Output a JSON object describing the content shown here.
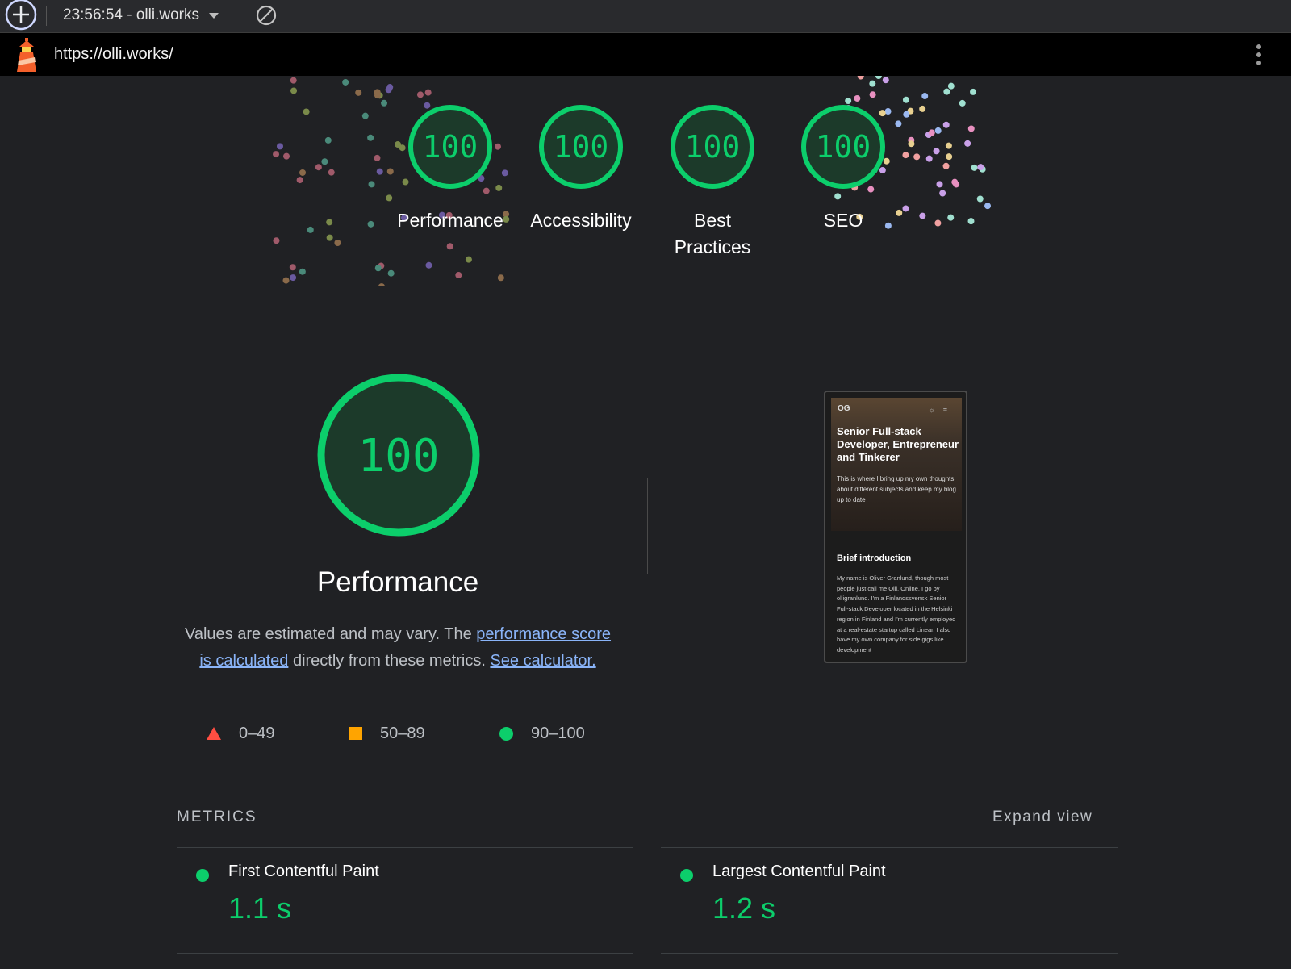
{
  "toolbar": {
    "report_label": "23:56:54 - olli.works"
  },
  "urlbar": {
    "url": "https://olli.works/"
  },
  "scores": [
    {
      "score": "100",
      "label": "Performance"
    },
    {
      "score": "100",
      "label": "Accessibility"
    },
    {
      "score": "100",
      "label": "Best Practices"
    },
    {
      "score": "100",
      "label": "SEO"
    }
  ],
  "performance": {
    "score": "100",
    "title": "Performance",
    "desc_1": "Values are estimated and may vary. The ",
    "desc_link_1": "performance score is calculated",
    "desc_2": " directly from these metrics. ",
    "desc_link_2": "See calculator.",
    "legend": [
      {
        "range": "0–49",
        "color": "#ff4e42"
      },
      {
        "range": "50–89",
        "color": "#ffa400"
      },
      {
        "range": "90–100",
        "color": "#0cce6b"
      }
    ]
  },
  "thumbnail": {
    "logo": "OG",
    "headline": "Senior Full-stack Developer, Entrepreneur and Tinkerer",
    "intro": "This is where I bring up my own thoughts about different subjects and keep my blog up to date",
    "section_title": "Brief introduction",
    "section_body": "My name is Oliver Granlund, though most people just call me Olli. Online, I go by olligranlund. I'm a Finlandssvensk Senior Full-stack Developer located in the Helsinki region in Finland and I'm currently employed at a real-estate startup called Linear. I also have my own company for side gigs like development"
  },
  "metrics": {
    "title": "METRICS",
    "expand_label": "Expand view",
    "items": [
      {
        "name": "First Contentful Paint",
        "value": "1.1 s"
      },
      {
        "name": "Largest Contentful Paint",
        "value": "1.2 s"
      }
    ]
  },
  "colors": {
    "pass": "#0cce6b",
    "average": "#ffa400",
    "fail": "#ff4e42",
    "background": "#202124"
  }
}
